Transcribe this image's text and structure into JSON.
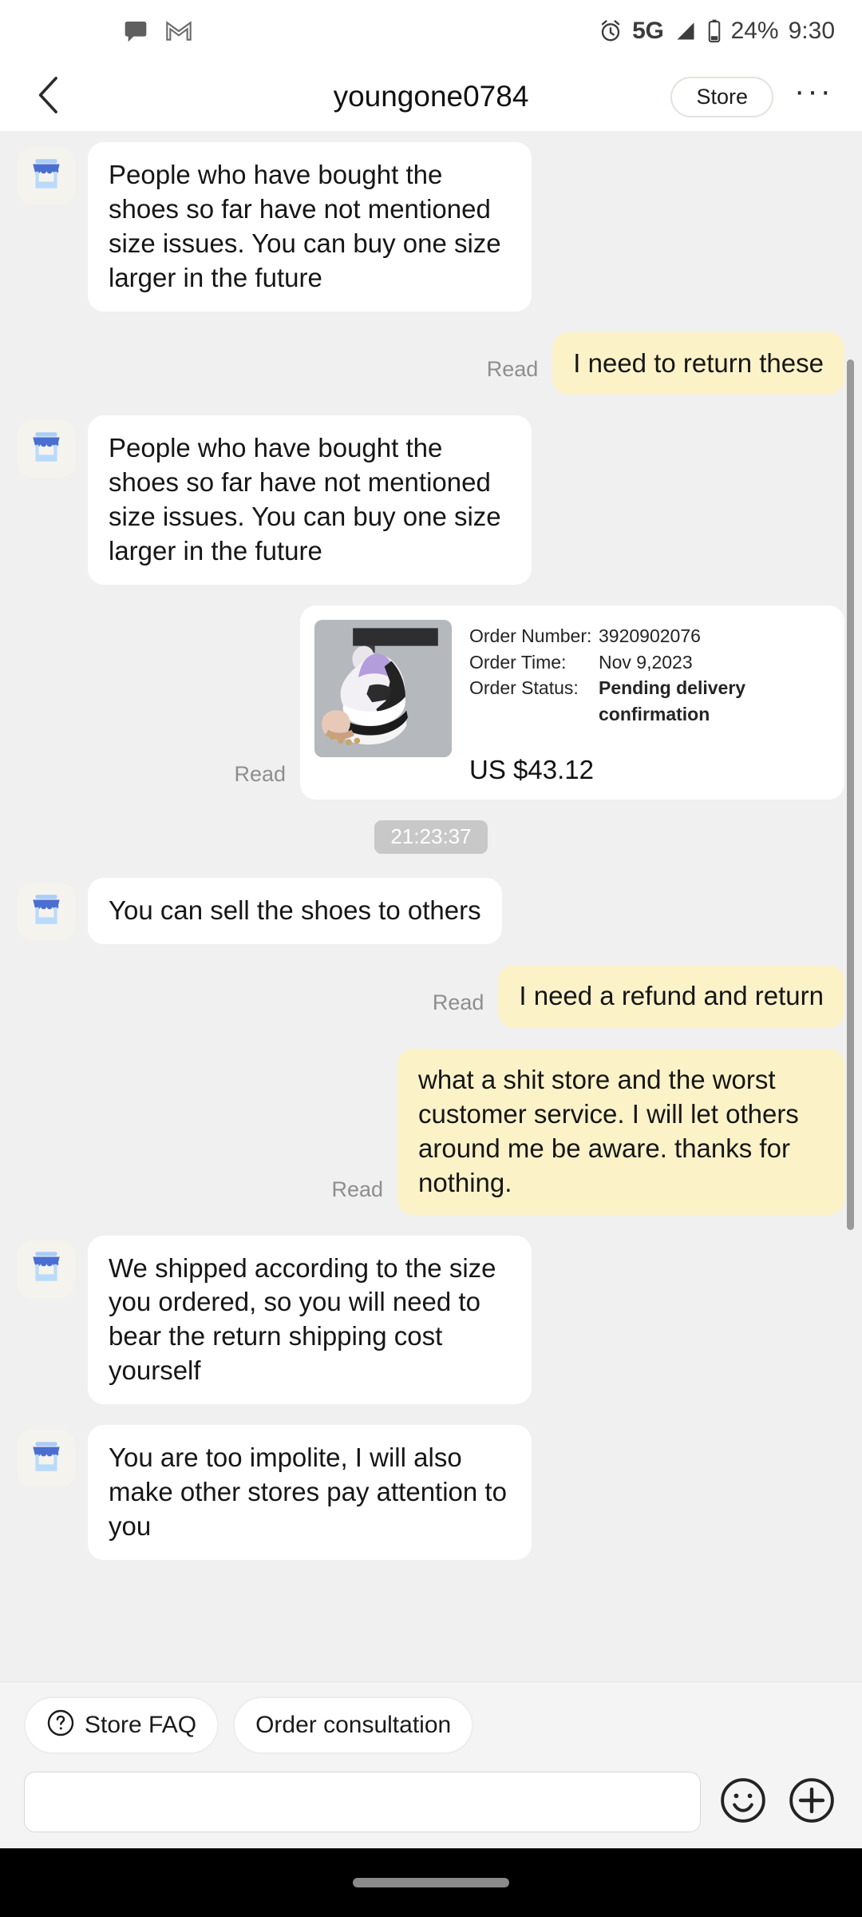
{
  "status_bar": {
    "left_icons": [
      "chat-bubble-icon",
      "gmail-icon"
    ],
    "alarm_icon": "alarm-clock-icon",
    "network": "5G",
    "signal_icon": "signal-bars-icon",
    "battery_icon": "battery-icon",
    "battery_percent": "24%",
    "time": "9:30"
  },
  "header": {
    "back_icon": "chevron-left-icon",
    "title": "youngone0784",
    "store_button": "Store",
    "more_menu": "···"
  },
  "chat": {
    "avatar_icon": "storefront-icon",
    "read_label": "Read",
    "time_divider": "21:23:37",
    "messages": [
      {
        "sender": "store",
        "text": "People who have bought the shoes so far have not mentioned size issues. You can buy one size larger in the future"
      },
      {
        "sender": "user",
        "text": "I need to return these",
        "status": "Read"
      },
      {
        "sender": "store",
        "text": "People who have bought the shoes so far have not mentioned size issues. You can buy one size larger in the future"
      },
      {
        "sender": "user",
        "type": "order_card",
        "status": "Read"
      },
      {
        "sender": "store",
        "text": "You can sell the shoes to others"
      },
      {
        "sender": "user",
        "text": "I need a refund and return",
        "status": "Read"
      },
      {
        "sender": "user",
        "text": "what a shit store and the worst customer service. I will let others around me be aware. thanks for nothing.",
        "status": "Read"
      },
      {
        "sender": "store",
        "text": "We shipped according to the size you ordered, so you will need to bear the return shipping cost yourself"
      },
      {
        "sender": "store",
        "text": "You are too impolite, I will also make other stores pay attention to you"
      }
    ]
  },
  "order_card": {
    "thumb_alt": "sneaker-photo",
    "fields": [
      {
        "label": "Order Number:",
        "value": "3920902076",
        "bold": false
      },
      {
        "label": "Order Time:",
        "value": "Nov 9,2023",
        "bold": false
      },
      {
        "label": "Order Status:",
        "value": "Pending delivery confirmation",
        "bold": true
      }
    ],
    "price": "US $43.12"
  },
  "bottom_bar": {
    "chips": [
      {
        "icon": "question-circle-icon",
        "label": "Store FAQ"
      },
      {
        "icon": "",
        "label": "Order consultation"
      }
    ],
    "input_placeholder": "",
    "input_value": "",
    "emoji_icon": "smiley-face-icon",
    "plus_icon": "plus-circle-icon"
  },
  "colors": {
    "chat_background": "#f0f0f0",
    "incoming_bubble": "#ffffff",
    "outgoing_bubble": "#fcf2c8",
    "avatar_background": "#f5f3ee",
    "awning_dark": "#4a6fd0",
    "awning_light": "#a9cdf7",
    "time_pill": "#c8c8c8",
    "scrollbar": "#9a9a9a",
    "nav_bar": "#000000"
  }
}
